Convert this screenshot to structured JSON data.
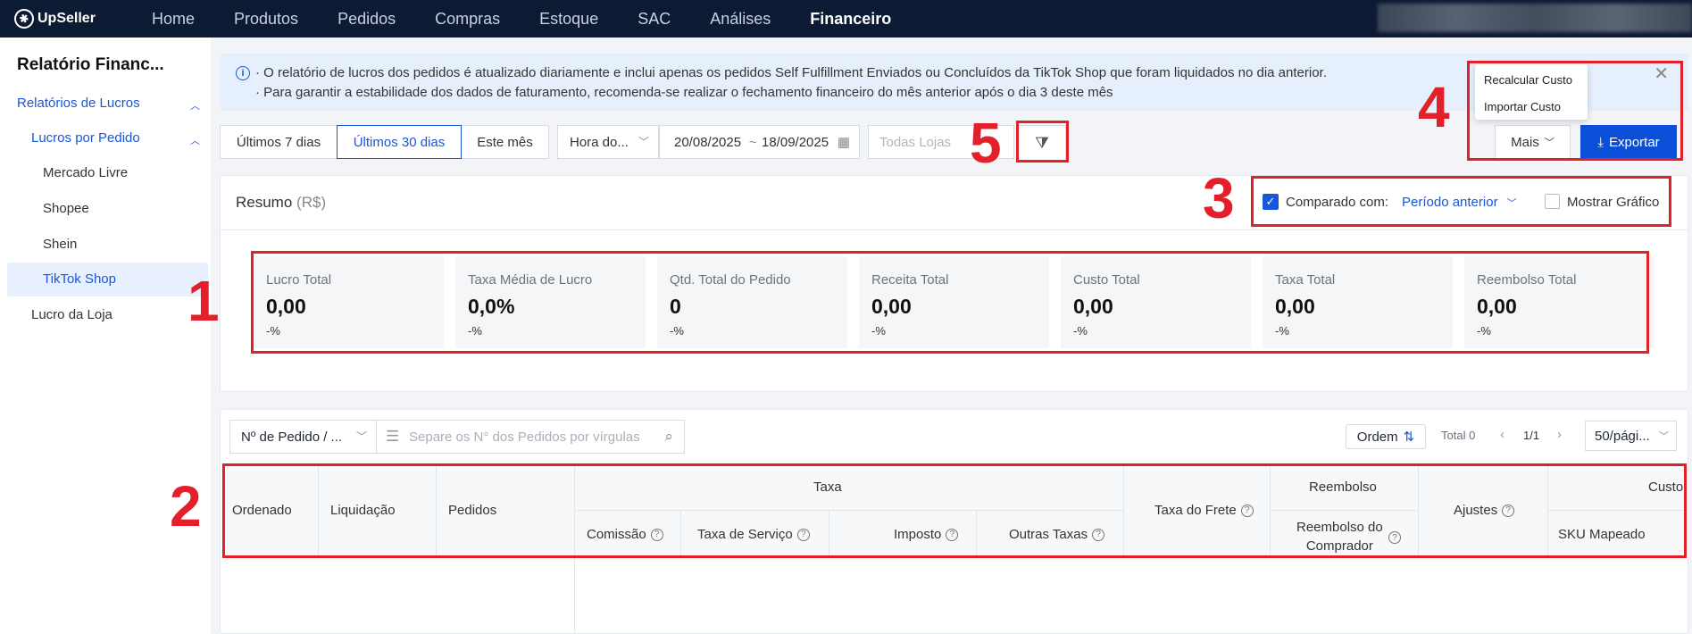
{
  "app": {
    "logo": "UpSeller"
  },
  "nav": [
    "Home",
    "Produtos",
    "Pedidos",
    "Compras",
    "Estoque",
    "SAC",
    "Análises",
    "Financeiro"
  ],
  "sidebar": {
    "title": "Relatório Financ...",
    "group": "Relatórios de Lucros",
    "subgroup": "Lucros por Pedido",
    "items": [
      "Mercado Livre",
      "Shopee",
      "Shein",
      "TikTok Shop"
    ],
    "active": "TikTok Shop",
    "other": "Lucro da Loja"
  },
  "banner": {
    "line1": "· O relatório de lucros dos pedidos é atualizado diariamente e inclui apenas os pedidos Self Fulfillment Enviados ou Concluídos da TikTok Shop que foram liquidados no dia anterior.",
    "line2": "· Para garantir a estabilidade dos dados de faturamento, recomenda-se realizar o fechamento financeiro do mês anterior após o dia 3 deste mês"
  },
  "filters": {
    "range_buttons": [
      "Últimos 7 dias",
      "Últimos 30 dias",
      "Este mês"
    ],
    "selected_range": "Últimos 30 dias",
    "time_type": "Hora do...",
    "date_start": "20/08/2025",
    "date_sep": "~",
    "date_end": "18/09/2025",
    "store_placeholder": "Todas Lojas"
  },
  "actions": {
    "more": "Mais",
    "export": "Exportar",
    "menu": [
      "Recalcular Custo",
      "Importar Custo"
    ]
  },
  "summary": {
    "title": "Resumo",
    "currency": "(R$)",
    "compare_label": "Comparado com:",
    "compare_value": "Período anterior",
    "compare_checked": true,
    "show_chart": "Mostrar Gráfico",
    "show_chart_checked": false,
    "cards": [
      {
        "label": "Lucro Total",
        "value": "0,00",
        "pct": "-%"
      },
      {
        "label": "Taxa Média de Lucro",
        "value": "0,0%",
        "pct": "-%"
      },
      {
        "label": "Qtd. Total do Pedido",
        "value": "0",
        "pct": "-%"
      },
      {
        "label": "Receita Total",
        "value": "0,00",
        "pct": "-%"
      },
      {
        "label": "Custo Total",
        "value": "0,00",
        "pct": "-%"
      },
      {
        "label": "Taxa Total",
        "value": "0,00",
        "pct": "-%"
      },
      {
        "label": "Reembolso Total",
        "value": "0,00",
        "pct": "-%"
      }
    ]
  },
  "table": {
    "search_type": "Nº de Pedido / ...",
    "search_placeholder": "Separe os N° dos Pedidos por vírgulas",
    "order_label": "Ordem",
    "total": "Total 0",
    "page": "1/1",
    "page_size": "50/pági...",
    "headers": {
      "ordenado": "Ordenado",
      "liquidacao": "Liquidação",
      "pedidos": "Pedidos",
      "taxa": "Taxa",
      "comissao": "Comissão",
      "taxa_servico": "Taxa de Serviço",
      "imposto": "Imposto",
      "outras": "Outras Taxas",
      "frete": "Taxa do Frete",
      "reembolso": "Reembolso",
      "reembolso_comprador_1": "Reembolso do",
      "reembolso_comprador_2": "Comprador",
      "ajustes": "Ajustes",
      "custo": "Custo",
      "sku": "SKU Mapeado"
    }
  },
  "annotations": [
    "1",
    "2",
    "3",
    "4",
    "5"
  ],
  "colors": {
    "accent": "#1a56db",
    "annotation": "#e3202a",
    "nav_bg": "#0d1a33"
  }
}
